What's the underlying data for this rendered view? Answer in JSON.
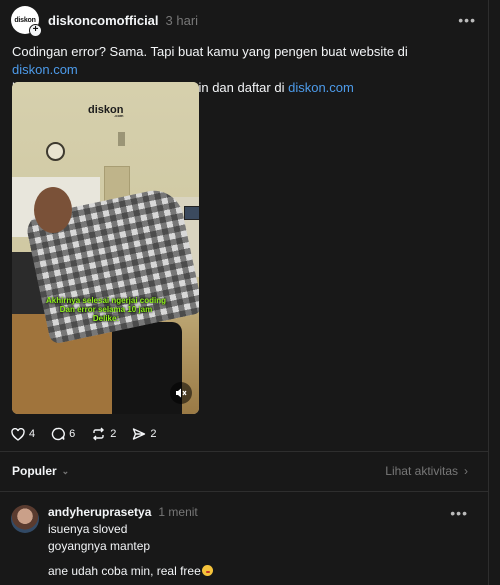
{
  "post": {
    "avatar_text": "diskon",
    "username": "diskoncomofficial",
    "time": "3 hari",
    "caption_part1": "Codingan error? Sama. Tapi buat kamu yang pengen buat website di ",
    "caption_link1": "diskon.com",
    "caption_part2": " hostingnya gratis langsung cobain dan daftar di ",
    "caption_link2": "diskon.com",
    "video": {
      "brand": "diskon",
      "brand_sub": ".com",
      "subtitle_line1": "Akhirnya selesai ngerjai coding",
      "subtitle_line2": "Dan error selama 10 jam",
      "subtitle_line3": "Delike:"
    },
    "actions": {
      "likes": "4",
      "comments": "6",
      "reposts": "2",
      "shares": "2"
    }
  },
  "sort": {
    "label": "Populer",
    "activity_link": "Lihat aktivitas"
  },
  "comment": {
    "username": "andyheruprasetya",
    "time": "1 menit",
    "line1": "isuenya sloved",
    "line2": "goyangnya mantep",
    "line3": "ane udah coba min, real free"
  },
  "colors": {
    "background": "#181818",
    "link": "#4d9bea",
    "muted": "#777777",
    "subtitle": "#8ff01c"
  }
}
